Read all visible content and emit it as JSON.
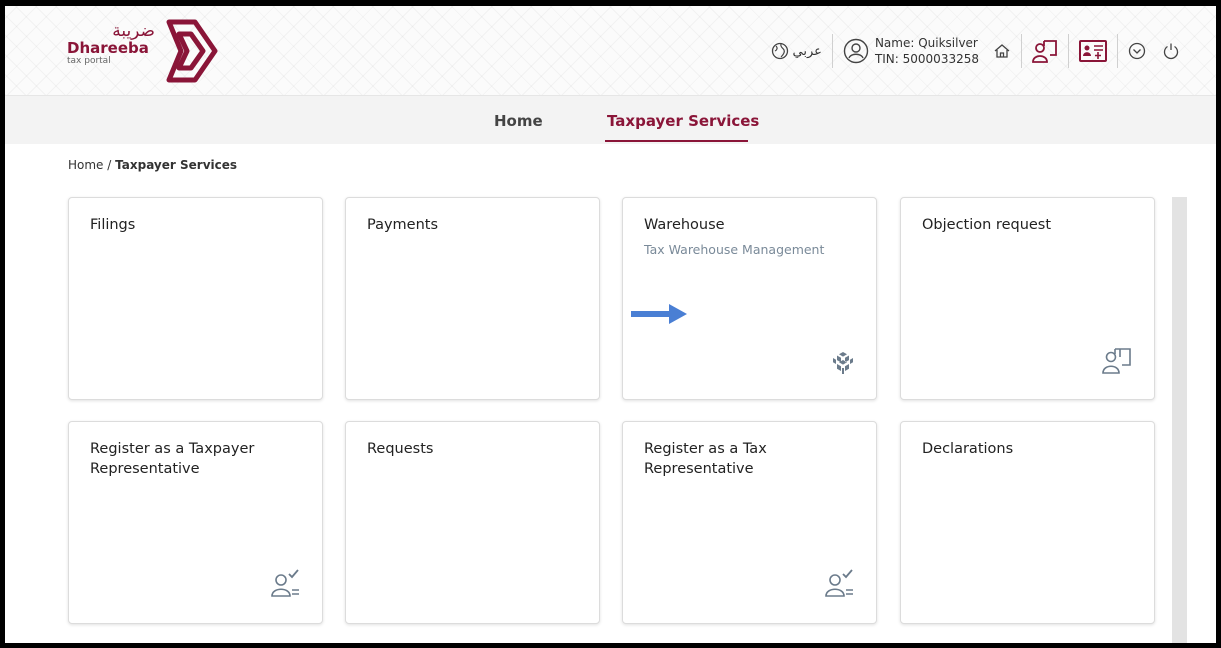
{
  "header": {
    "logo": {
      "arabic": "ضريبة",
      "name": "Dhareeba",
      "sub": "tax portal"
    },
    "language_label": "عربي",
    "user": {
      "name": "Name: Quiksilver",
      "tin": "TIN: 5000033258"
    },
    "icons": [
      "globe-icon",
      "user-circle-icon",
      "home-icon",
      "objection-icon",
      "id-card-add-icon",
      "chevron-down-circle-icon",
      "power-icon"
    ]
  },
  "nav": {
    "items": [
      {
        "label": "Home"
      },
      {
        "label": "Taxpayer Services"
      }
    ],
    "active": "Taxpayer Services"
  },
  "breadcrumb": {
    "home": "Home",
    "separator": "/",
    "current": "Taxpayer Services"
  },
  "cards": [
    {
      "title": "Filings"
    },
    {
      "title": "Payments"
    },
    {
      "title": "Warehouse",
      "subtitle": "Tax Warehouse Management",
      "icon": "cubes-icon"
    },
    {
      "title": "Objection request",
      "icon": "objection-icon"
    },
    {
      "title": "Register as a Taxpayer Representative",
      "icon": "user-check-icon"
    },
    {
      "title": "Requests"
    },
    {
      "title": "Register as a Tax Representative",
      "icon": "user-check-icon"
    },
    {
      "title": "Declarations"
    }
  ],
  "colors": {
    "brand": "#8a1538",
    "arrow": "#4a7fd4",
    "icon": "#6b7b8b"
  }
}
